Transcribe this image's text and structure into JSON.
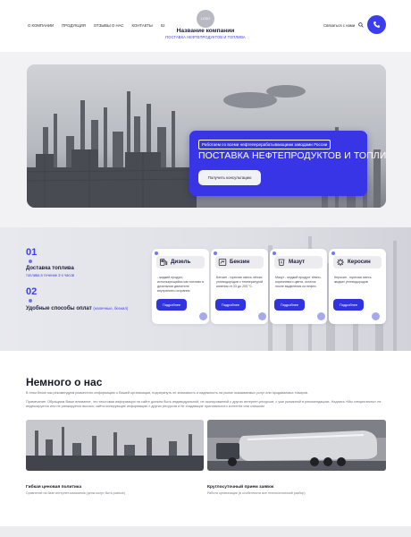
{
  "header": {
    "nav": [
      "О КОМПАНИИ",
      "ПРОДУКЦИЯ",
      "ОТЗЫВЫ О НАС",
      "КОНТАКТЫ",
      "02"
    ],
    "logo_text": "LOGO",
    "company_name": "Название компании",
    "company_tagline": "ПОСТАВКА НЕФТЕПРОДУКТОВ И ТОПЛИВА",
    "contact_link": "Связаться с нами",
    "accent_color": "#3a3ef0"
  },
  "hero": {
    "tag": "Работаем со всеми нефтеперерабатывающими заводами России",
    "title": "ПОСТАВКА НЕФТЕПРОДУКТОВ И ТОПЛИВА",
    "button": "Получить консультацию"
  },
  "features": [
    {
      "num": "01",
      "title": "Доставка топлива",
      "subtitle": "топлива в течение 2-х часов"
    },
    {
      "num": "02",
      "title": "Удобные способы оплат",
      "subtitle": "(наличные, безнал)"
    }
  ],
  "fuels": [
    {
      "name": "Дизель",
      "icon": "fuel-pump-icon",
      "desc": "- жидкий продукт, использующийся как топливо в дизельном двигателе внутреннего сгорания",
      "button": "Подробнее"
    },
    {
      "name": "Бензин",
      "icon": "gas-station-icon",
      "desc": "Бензин - горючая смесь лёгких углеводородов с температурой кипения от 33 до 205 °C.",
      "button": "Подробнее"
    },
    {
      "name": "Мазут",
      "icon": "oil-barrel-icon",
      "desc": "Мазут - жидкий продукт тёмно-коричневого цвета, остаток после выделения из нефти.",
      "button": "Подробнее"
    },
    {
      "name": "Керосин",
      "icon": "refinery-icon",
      "desc": "Керосин - горючая смесь жидких углеводородов",
      "button": "Подробнее"
    }
  ],
  "about": {
    "title": "Немного о нас",
    "p1": "В этом блоке мы рекомендуем разместить информацию о Вашей организации, подчеркнуть ее значимость и надежность на рынке оказываемых услуг или продаваемых товаров.",
    "p2": "Примечание: Обращаем Ваше внимание, что текстовая информация на сайте должна быть индивидуальной, не скопированной с других интернет-ресурсов, с уже указанной в рекомендациях. Надпись «Мы специалисты» не индексируется или не ранжируется высоко: сайты копирующие информацию с других ресурсов и не создающие оригинального контента или слишком",
    "items": [
      {
        "title": "Гибкая ценовая политика",
        "subtitle": "Сравнение на базе интернет-магазинов (цены могут быть разные)"
      },
      {
        "title": "Круглосуточный прием заявок",
        "subtitle": "Работа организации (в особенности все технологический разбор)"
      }
    ]
  }
}
